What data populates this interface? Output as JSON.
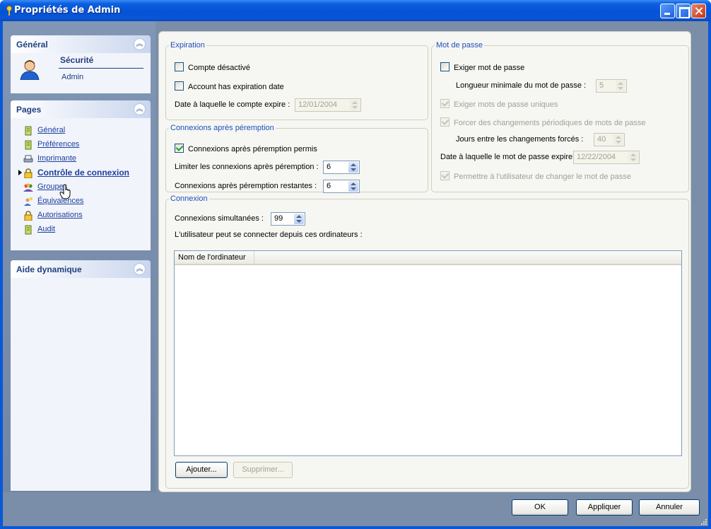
{
  "window": {
    "title": "Propriétés de Admin"
  },
  "left": {
    "general": {
      "header": "Général",
      "section_title": "Sécurité",
      "section_sub": "Admin"
    },
    "pages": {
      "header": "Pages",
      "items": [
        {
          "label": "Général",
          "icon": "document-icon"
        },
        {
          "label": "Préférences",
          "icon": "document-icon"
        },
        {
          "label": "Imprimante",
          "icon": "printer-icon"
        },
        {
          "label": "Contrôle de connexion",
          "icon": "lock-icon",
          "active": true
        },
        {
          "label": "Groupes",
          "icon": "group-icon"
        },
        {
          "label": "Équivalences",
          "icon": "user-key-icon"
        },
        {
          "label": "Autorisations",
          "icon": "lock-icon"
        },
        {
          "label": "Audit",
          "icon": "document-icon"
        }
      ]
    },
    "dynamic_help": {
      "header": "Aide dynamique"
    }
  },
  "expiration": {
    "legend": "Expiration",
    "disabled_label": "Compte désactivé",
    "has_expiration_label": "Account has expiration date",
    "expire_date_label": "Date à laquelle le compte expire :",
    "expire_date_value": "12/01/2004"
  },
  "grace": {
    "legend": "Connexions après péremption",
    "allowed_label": "Connexions après péremption permis",
    "limit_label": "Limiter les connexions après péremption :",
    "limit_value": "6",
    "remaining_label": "Connexions après péremption restantes :",
    "remaining_value": "6"
  },
  "password": {
    "legend": "Mot de passe",
    "require_label": "Exiger mot de passe",
    "min_length_label": "Longueur minimale du mot de passe :",
    "min_length_value": "5",
    "unique_label": "Exiger mots de passe uniques",
    "periodic_label": "Forcer des changements périodiques de mots de passe",
    "days_label": "Jours entre les changements forcés :",
    "days_value": "40",
    "expire_label": "Date à laquelle le mot de passe expire :",
    "expire_value": "12/22/2004",
    "user_change_label": "Permettre à l'utilisateur de changer le mot de passe"
  },
  "connection": {
    "legend": "Connexion",
    "simultaneous_label": "Connexions simultanées :",
    "simultaneous_value": "99",
    "computers_label": "L'utilisateur peut se connecter depuis ces ordinateurs :",
    "column_header": "Nom de l'ordinateur",
    "add_label": "Ajouter...",
    "remove_label": "Supprimer..."
  },
  "footer": {
    "ok": "OK",
    "apply": "Appliquer",
    "cancel": "Annuler"
  },
  "colors": {
    "titlebar": "#0552d6",
    "pane": "#7a8ea9",
    "link": "#1d3f9e",
    "legend": "#1d4fbf"
  }
}
